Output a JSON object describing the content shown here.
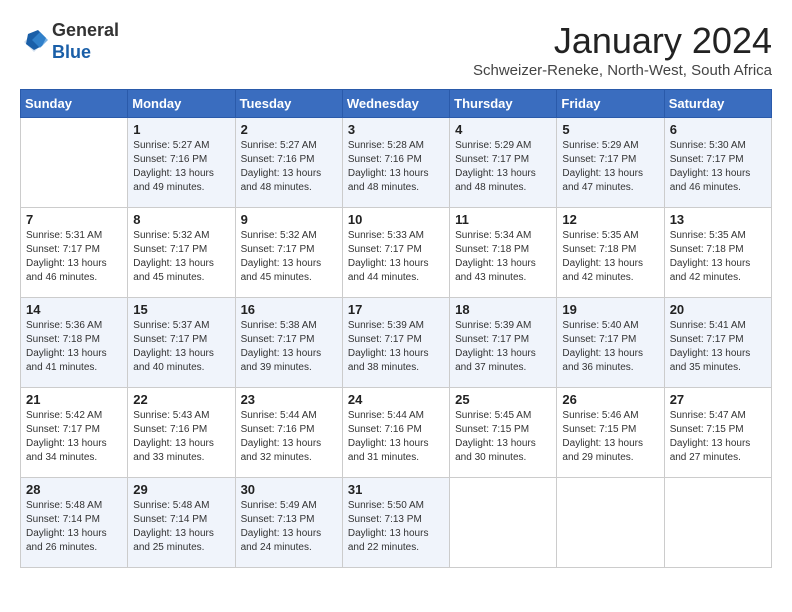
{
  "header": {
    "logo_general": "General",
    "logo_blue": "Blue",
    "month": "January 2024",
    "location": "Schweizer-Reneke, North-West, South Africa"
  },
  "weekdays": [
    "Sunday",
    "Monday",
    "Tuesday",
    "Wednesday",
    "Thursday",
    "Friday",
    "Saturday"
  ],
  "weeks": [
    [
      {
        "day": "",
        "info": ""
      },
      {
        "day": "1",
        "info": "Sunrise: 5:27 AM\nSunset: 7:16 PM\nDaylight: 13 hours\nand 49 minutes."
      },
      {
        "day": "2",
        "info": "Sunrise: 5:27 AM\nSunset: 7:16 PM\nDaylight: 13 hours\nand 48 minutes."
      },
      {
        "day": "3",
        "info": "Sunrise: 5:28 AM\nSunset: 7:16 PM\nDaylight: 13 hours\nand 48 minutes."
      },
      {
        "day": "4",
        "info": "Sunrise: 5:29 AM\nSunset: 7:17 PM\nDaylight: 13 hours\nand 48 minutes."
      },
      {
        "day": "5",
        "info": "Sunrise: 5:29 AM\nSunset: 7:17 PM\nDaylight: 13 hours\nand 47 minutes."
      },
      {
        "day": "6",
        "info": "Sunrise: 5:30 AM\nSunset: 7:17 PM\nDaylight: 13 hours\nand 46 minutes."
      }
    ],
    [
      {
        "day": "7",
        "info": "Sunrise: 5:31 AM\nSunset: 7:17 PM\nDaylight: 13 hours\nand 46 minutes."
      },
      {
        "day": "8",
        "info": "Sunrise: 5:32 AM\nSunset: 7:17 PM\nDaylight: 13 hours\nand 45 minutes."
      },
      {
        "day": "9",
        "info": "Sunrise: 5:32 AM\nSunset: 7:17 PM\nDaylight: 13 hours\nand 45 minutes."
      },
      {
        "day": "10",
        "info": "Sunrise: 5:33 AM\nSunset: 7:17 PM\nDaylight: 13 hours\nand 44 minutes."
      },
      {
        "day": "11",
        "info": "Sunrise: 5:34 AM\nSunset: 7:18 PM\nDaylight: 13 hours\nand 43 minutes."
      },
      {
        "day": "12",
        "info": "Sunrise: 5:35 AM\nSunset: 7:18 PM\nDaylight: 13 hours\nand 42 minutes."
      },
      {
        "day": "13",
        "info": "Sunrise: 5:35 AM\nSunset: 7:18 PM\nDaylight: 13 hours\nand 42 minutes."
      }
    ],
    [
      {
        "day": "14",
        "info": "Sunrise: 5:36 AM\nSunset: 7:18 PM\nDaylight: 13 hours\nand 41 minutes."
      },
      {
        "day": "15",
        "info": "Sunrise: 5:37 AM\nSunset: 7:17 PM\nDaylight: 13 hours\nand 40 minutes."
      },
      {
        "day": "16",
        "info": "Sunrise: 5:38 AM\nSunset: 7:17 PM\nDaylight: 13 hours\nand 39 minutes."
      },
      {
        "day": "17",
        "info": "Sunrise: 5:39 AM\nSunset: 7:17 PM\nDaylight: 13 hours\nand 38 minutes."
      },
      {
        "day": "18",
        "info": "Sunrise: 5:39 AM\nSunset: 7:17 PM\nDaylight: 13 hours\nand 37 minutes."
      },
      {
        "day": "19",
        "info": "Sunrise: 5:40 AM\nSunset: 7:17 PM\nDaylight: 13 hours\nand 36 minutes."
      },
      {
        "day": "20",
        "info": "Sunrise: 5:41 AM\nSunset: 7:17 PM\nDaylight: 13 hours\nand 35 minutes."
      }
    ],
    [
      {
        "day": "21",
        "info": "Sunrise: 5:42 AM\nSunset: 7:17 PM\nDaylight: 13 hours\nand 34 minutes."
      },
      {
        "day": "22",
        "info": "Sunrise: 5:43 AM\nSunset: 7:16 PM\nDaylight: 13 hours\nand 33 minutes."
      },
      {
        "day": "23",
        "info": "Sunrise: 5:44 AM\nSunset: 7:16 PM\nDaylight: 13 hours\nand 32 minutes."
      },
      {
        "day": "24",
        "info": "Sunrise: 5:44 AM\nSunset: 7:16 PM\nDaylight: 13 hours\nand 31 minutes."
      },
      {
        "day": "25",
        "info": "Sunrise: 5:45 AM\nSunset: 7:15 PM\nDaylight: 13 hours\nand 30 minutes."
      },
      {
        "day": "26",
        "info": "Sunrise: 5:46 AM\nSunset: 7:15 PM\nDaylight: 13 hours\nand 29 minutes."
      },
      {
        "day": "27",
        "info": "Sunrise: 5:47 AM\nSunset: 7:15 PM\nDaylight: 13 hours\nand 27 minutes."
      }
    ],
    [
      {
        "day": "28",
        "info": "Sunrise: 5:48 AM\nSunset: 7:14 PM\nDaylight: 13 hours\nand 26 minutes."
      },
      {
        "day": "29",
        "info": "Sunrise: 5:48 AM\nSunset: 7:14 PM\nDaylight: 13 hours\nand 25 minutes."
      },
      {
        "day": "30",
        "info": "Sunrise: 5:49 AM\nSunset: 7:13 PM\nDaylight: 13 hours\nand 24 minutes."
      },
      {
        "day": "31",
        "info": "Sunrise: 5:50 AM\nSunset: 7:13 PM\nDaylight: 13 hours\nand 22 minutes."
      },
      {
        "day": "",
        "info": ""
      },
      {
        "day": "",
        "info": ""
      },
      {
        "day": "",
        "info": ""
      }
    ]
  ]
}
